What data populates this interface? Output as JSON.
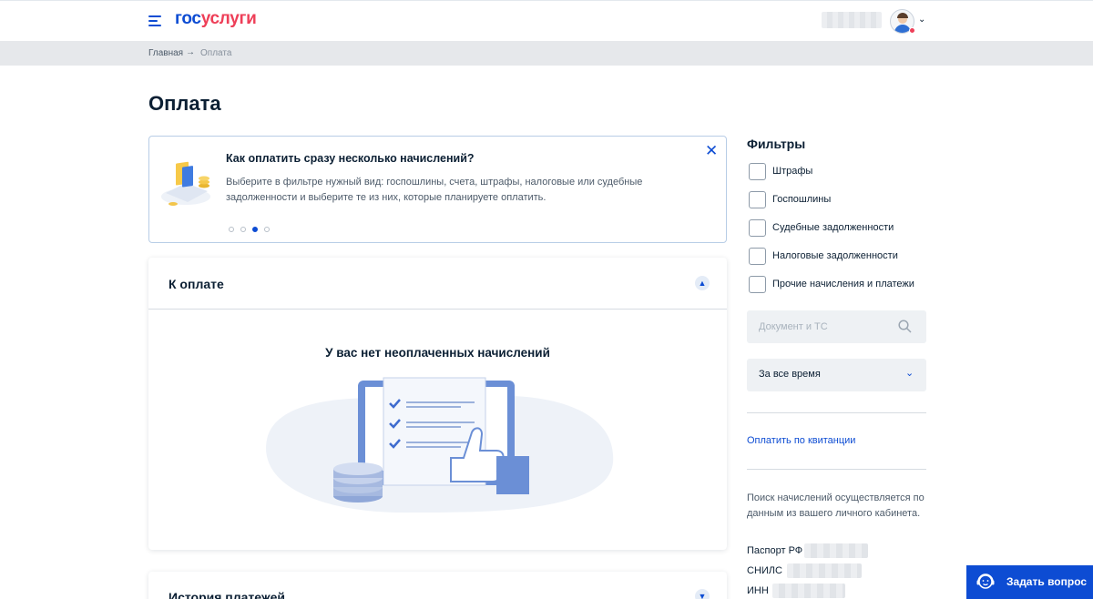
{
  "header": {
    "logo_part1": "гос",
    "logo_part2": "услуги"
  },
  "breadcrumb": {
    "home": "Главная",
    "separator": "→",
    "current": "Оплата"
  },
  "page": {
    "title": "Оплата"
  },
  "banner": {
    "title": "Как оплатить сразу несколько начислений?",
    "text": "Выберите в фильтре нужный вид: госпошлины, счета, штрафы, налоговые или судебные задолженности и выберите те из них, которые планируете оплатить.",
    "close": "✕",
    "pages": 4,
    "active_page": 3
  },
  "payment": {
    "title": "К оплате",
    "empty_message": "У вас нет неоплаченных начислений"
  },
  "history": {
    "title": "История платежей"
  },
  "filters": {
    "title": "Фильтры",
    "options": [
      {
        "label": "Штрафы",
        "checked": false
      },
      {
        "label": "Госпошлины",
        "checked": false
      },
      {
        "label": "Судебные задолженности",
        "checked": false
      },
      {
        "label": "Налоговые задолженности",
        "checked": false
      },
      {
        "label": "Прочие начисления и платежи",
        "checked": false
      }
    ],
    "search_placeholder": "Документ и ТС",
    "period_value": "За все время",
    "receipt_link": "Оплатить по квитанции",
    "note": "Поиск начислений осуществляется по данным из вашего личного кабинета.",
    "documents": {
      "passport": "Паспорт РФ",
      "snils": "СНИЛС",
      "inn": "ИНН"
    }
  },
  "help": {
    "ask_label": "Задать вопрос"
  },
  "colors": {
    "brand_blue": "#0d4cd3",
    "brand_red": "#ee3f58",
    "breadcrumb_bg": "#e6e8eb"
  }
}
